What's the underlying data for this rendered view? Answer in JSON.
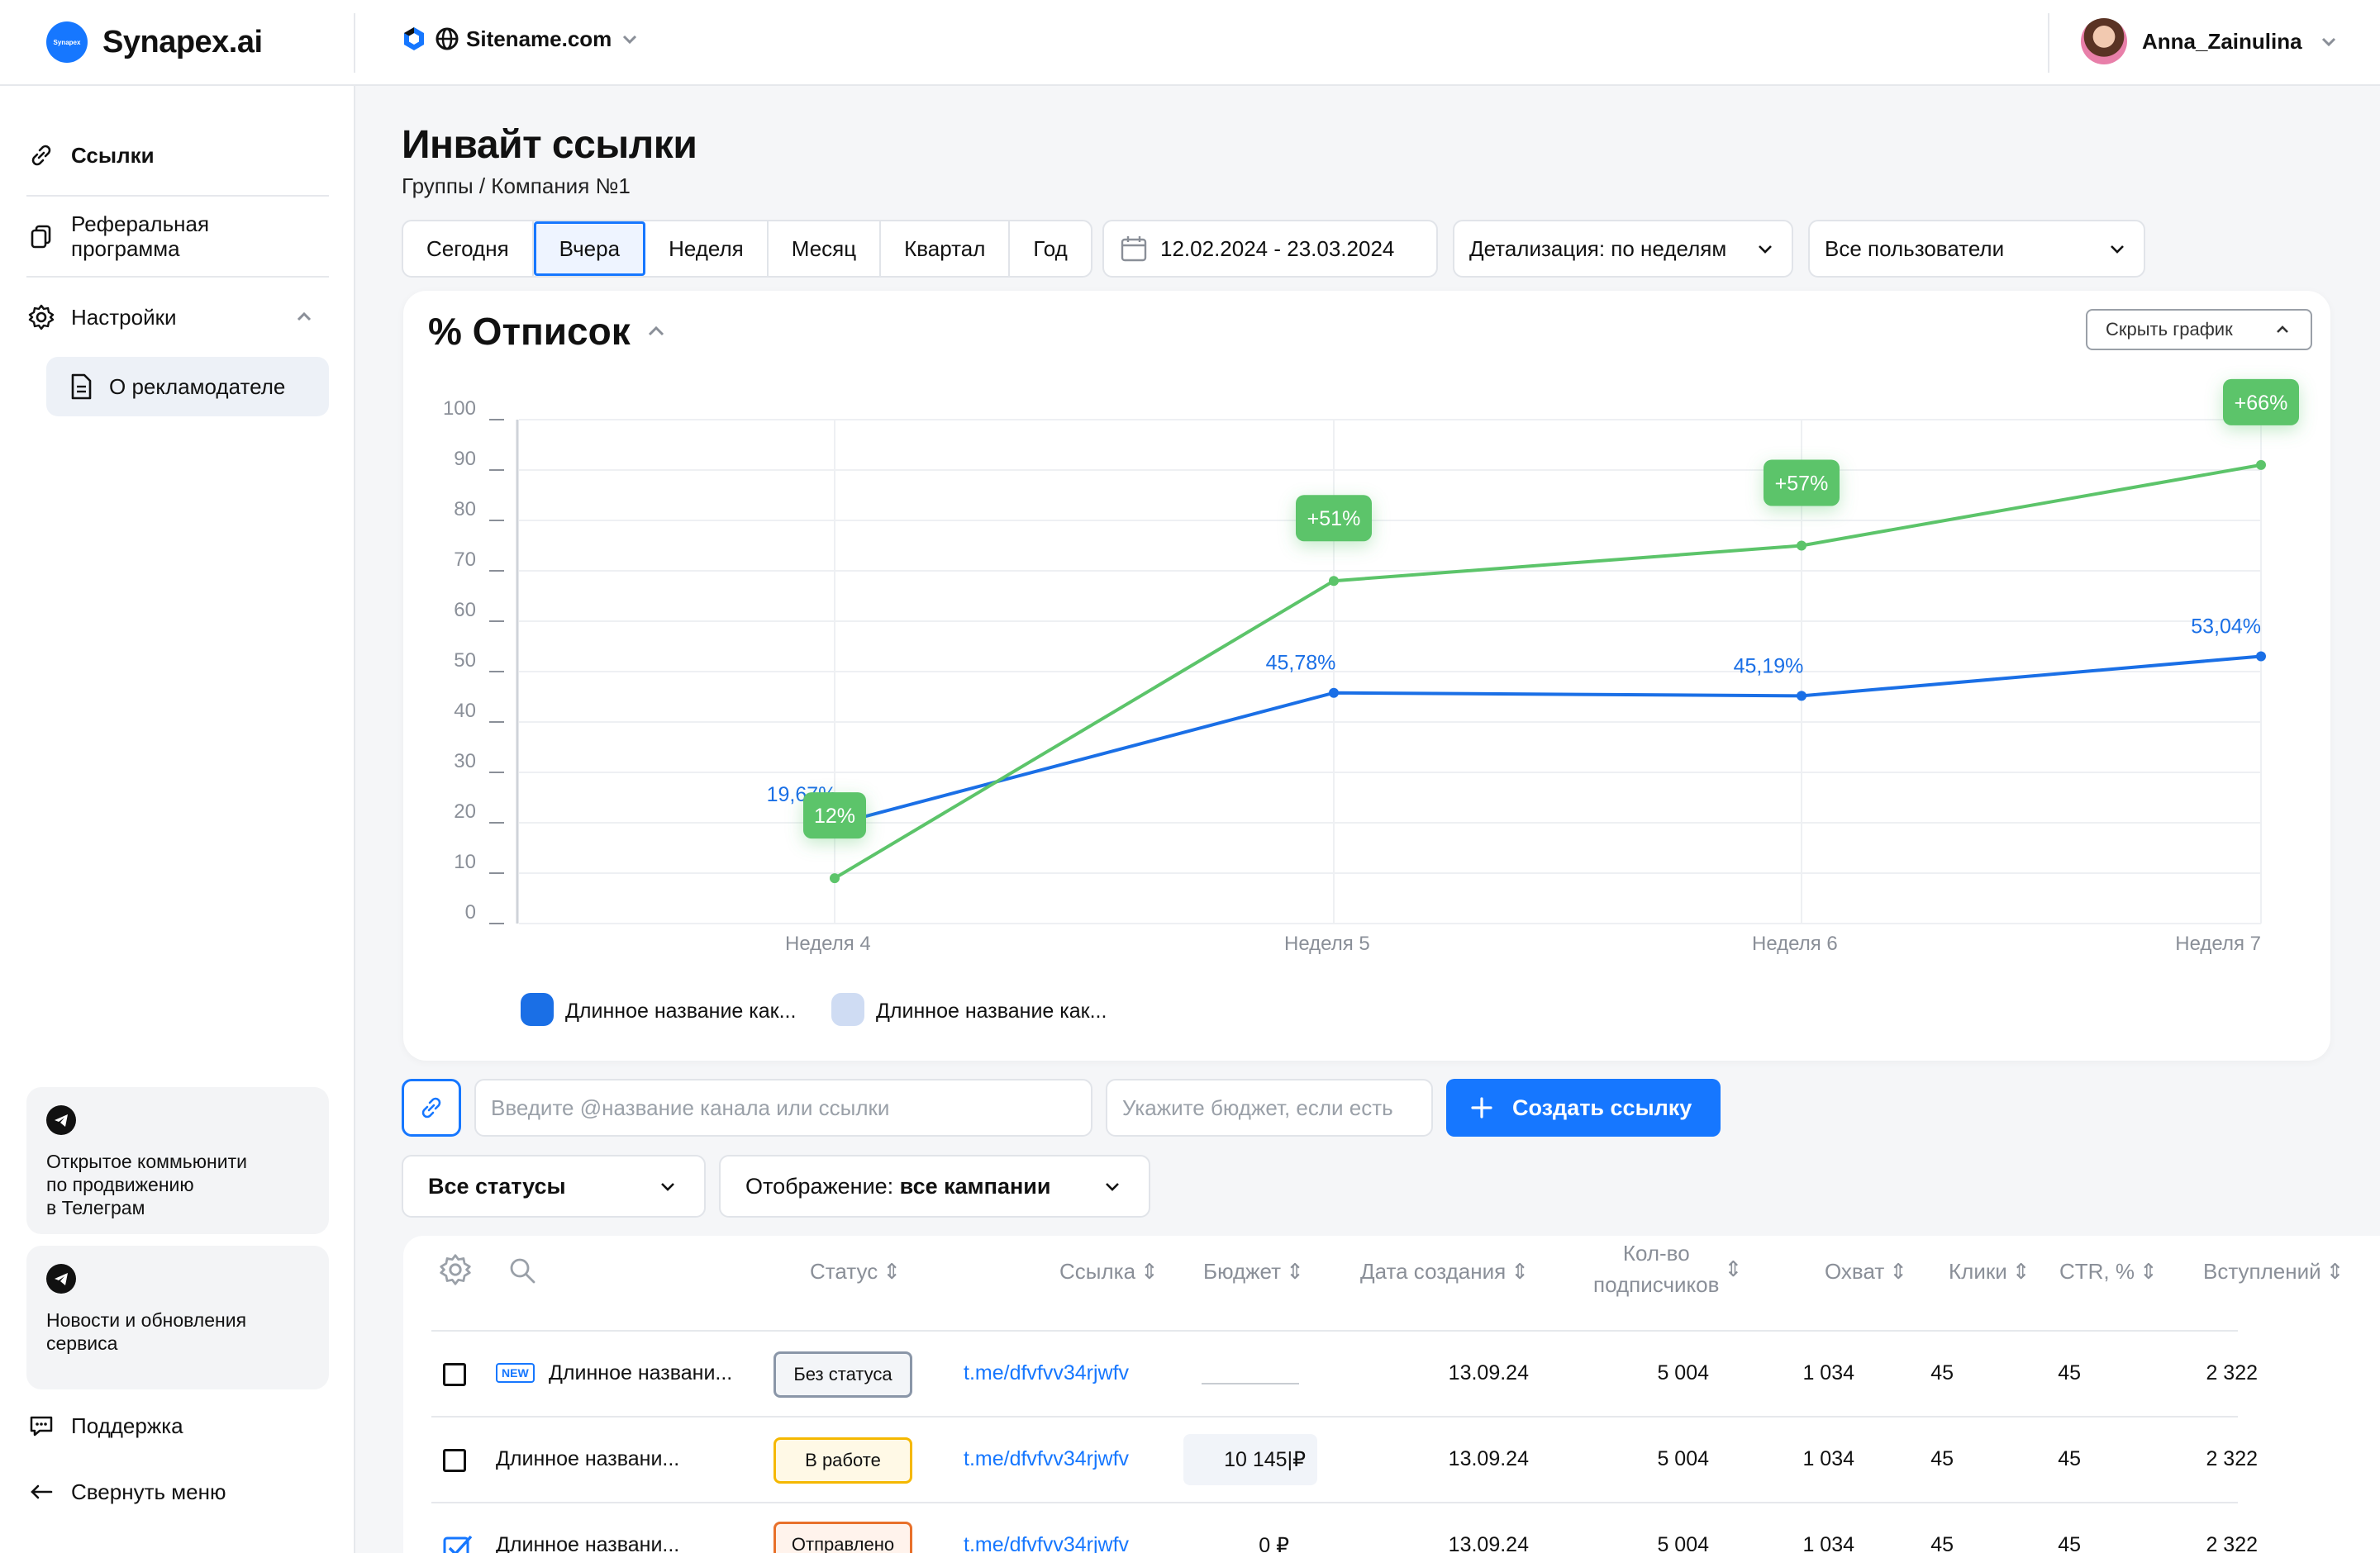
{
  "header": {
    "logo_badge": "Synapex",
    "brand": "Synapex.ai",
    "site": "Sitename.com",
    "user": "Anna_Zainulina"
  },
  "sidebar": {
    "items": [
      {
        "label": "Ссылки",
        "icon": "link-icon"
      },
      {
        "label": "Реферальная\nпрограмма",
        "icon": "copy-icon"
      },
      {
        "label": "Настройки",
        "icon": "gear-icon"
      }
    ],
    "sub_item": "О рекламодателе",
    "card1": "Открытое коммьюнити\nпо продвижению\nв Телеграм",
    "card2": "Новости и обновления\nсервиса",
    "support": "Поддержка",
    "collapse": "Свернуть меню"
  },
  "page": {
    "title": "Инвайт ссылки",
    "breadcrumb": "Группы / Компания №1",
    "periods": [
      "Сегодня",
      "Вчера",
      "Неделя",
      "Месяц",
      "Квартал",
      "Год"
    ],
    "active_period": "Вчера",
    "date_range": "12.02.2024 - 23.03.2024",
    "detail": "Детализация: по неделям",
    "users": "Все пользователи"
  },
  "chart_data": {
    "type": "line",
    "title": "% Отписок",
    "hide_label": "Скрыть график",
    "categories": [
      "Неделя 4",
      "Неделя 5",
      "Неделя 6",
      "Неделя 7"
    ],
    "yticks": [
      0,
      10,
      20,
      30,
      40,
      50,
      60,
      70,
      80,
      90,
      100
    ],
    "ylim": [
      0,
      100
    ],
    "grid": true,
    "series": [
      {
        "name": "Длинное название как...",
        "color": "#1a6fe6",
        "values": [
          19.67,
          45.78,
          45.19,
          53.04
        ],
        "labels": [
          "19,67%",
          "45,78%",
          "45,19%",
          "53,04%"
        ]
      },
      {
        "name": "Длинное название как...",
        "color": "#5cc46a",
        "values": [
          9,
          68,
          75,
          91
        ],
        "badges": [
          "12%",
          "+51%",
          "+57%",
          "+66%"
        ]
      }
    ],
    "legend_colors": [
      "#1a6fe6",
      "#cfdcf3"
    ],
    "legend_position": "bottom-left"
  },
  "controls": {
    "channel_placeholder": "Введите @название канала или ссылки",
    "budget_placeholder": "Укажите бюджет, если есть",
    "create": "Создать ссылку",
    "status_filter": "Все статусы",
    "view_prefix": "Отображение: ",
    "view_value": "все кампании"
  },
  "table": {
    "headers": [
      "Статус",
      "Ссылка",
      "Бюджет",
      "Дата создания",
      "Кол-во\nподписчиков",
      "Охват",
      "Клики",
      "CTR, %",
      "Вступлений"
    ],
    "rows": [
      {
        "checked": false,
        "new": "NEW",
        "name": "Длинное названи...",
        "status": "Без статуса",
        "status_color": "#8a96a8",
        "link": "t.me/dfvfvv34rjwfv",
        "budget": "",
        "date": "13.09.24",
        "subs": "5 004",
        "reach": "1 034",
        "clicks": "45",
        "ctr": "45",
        "joins": "2 322"
      },
      {
        "checked": false,
        "new": "",
        "name": "Длинное названи...",
        "status": "В работе",
        "status_color": "#f5b800",
        "link": "t.me/dfvfvv34rjwfv",
        "budget": "10 145|₽",
        "date": "13.09.24",
        "subs": "5 004",
        "reach": "1 034",
        "clicks": "45",
        "ctr": "45",
        "joins": "2 322"
      },
      {
        "checked": true,
        "new": "",
        "name": "Длинное названи...",
        "status": "Отправлено",
        "status_color": "#e8702a",
        "link": "t.me/dfvfvv34rjwfv",
        "budget": "0 ₽",
        "date": "13.09.24",
        "subs": "5 004",
        "reach": "1 034",
        "clicks": "45",
        "ctr": "45",
        "joins": "2 322"
      }
    ]
  }
}
